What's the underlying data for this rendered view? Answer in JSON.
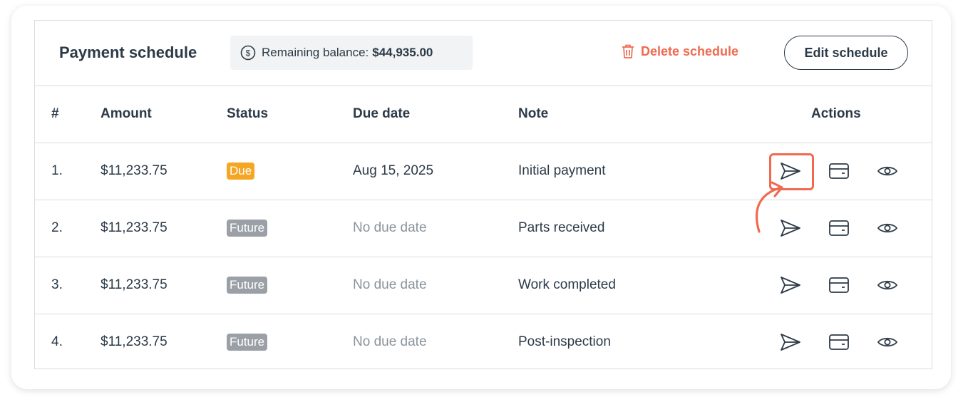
{
  "header": {
    "title": "Payment schedule",
    "balance_label": "Remaining balance:",
    "balance_amount": "$44,935.00",
    "delete_label": "Delete schedule",
    "edit_label": "Edit schedule"
  },
  "table": {
    "columns": [
      "#",
      "Amount",
      "Status",
      "Due date",
      "Note",
      "Actions"
    ],
    "rows": [
      {
        "num": "1.",
        "amount": "$11,233.75",
        "status": "Due",
        "due_date": "Aug 15, 2025",
        "note": "Initial payment"
      },
      {
        "num": "2.",
        "amount": "$11,233.75",
        "status": "Future",
        "due_date": "No due date",
        "note": "Parts received"
      },
      {
        "num": "3.",
        "amount": "$11,233.75",
        "status": "Future",
        "due_date": "No due date",
        "note": "Work completed"
      },
      {
        "num": "4.",
        "amount": "$11,233.75",
        "status": "Future",
        "due_date": "No due date",
        "note": "Post-inspection"
      }
    ],
    "action_icons": [
      "send-icon",
      "card-icon",
      "eye-icon"
    ]
  },
  "colors": {
    "accent": "#f06a4f",
    "due_badge": "#f5a623",
    "future_badge": "#9aa0a6",
    "text": "#2c3a48"
  }
}
